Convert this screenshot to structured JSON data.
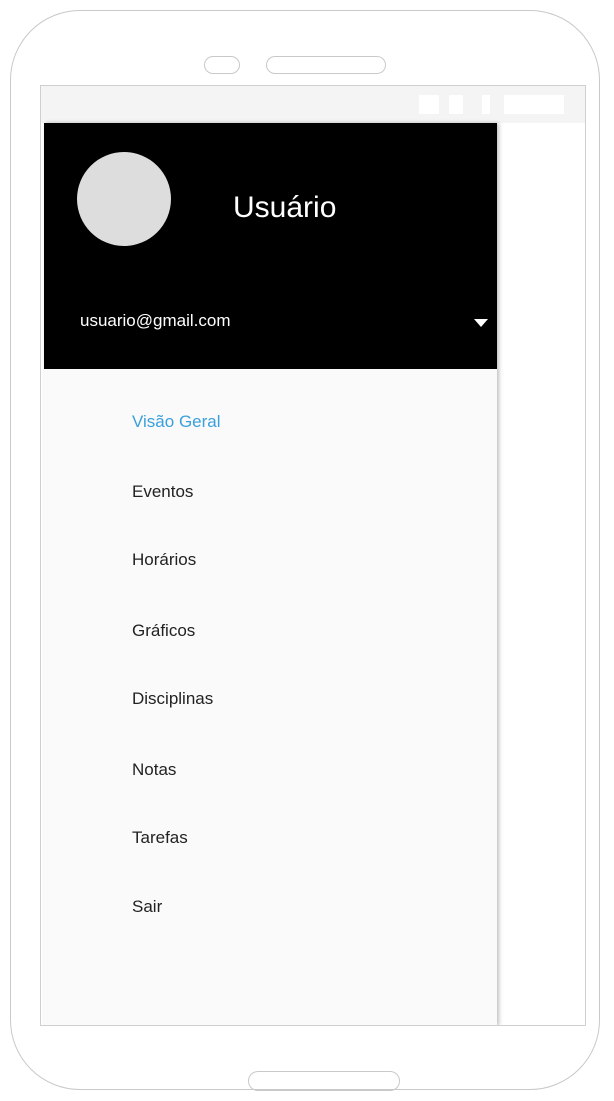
{
  "drawer": {
    "header": {
      "user_name": "Usuário",
      "email": "usuario@gmail.com",
      "dropdown_icon": "caret-down-icon"
    },
    "menu": {
      "items": [
        {
          "label": "Visão Geral",
          "active": true
        },
        {
          "label": "Eventos",
          "active": false
        },
        {
          "label": "Horários",
          "active": false
        },
        {
          "label": "Gráficos",
          "active": false
        },
        {
          "label": "Disciplinas",
          "active": false
        },
        {
          "label": "Notas",
          "active": false
        },
        {
          "label": "Tarefas",
          "active": false
        },
        {
          "label": "Sair",
          "active": false
        }
      ]
    }
  },
  "colors": {
    "header_background": "#000000",
    "drawer_background": "#fafafa",
    "active_item": "#3aa0dc",
    "item_text": "#222222",
    "avatar_placeholder": "#dddddd"
  }
}
